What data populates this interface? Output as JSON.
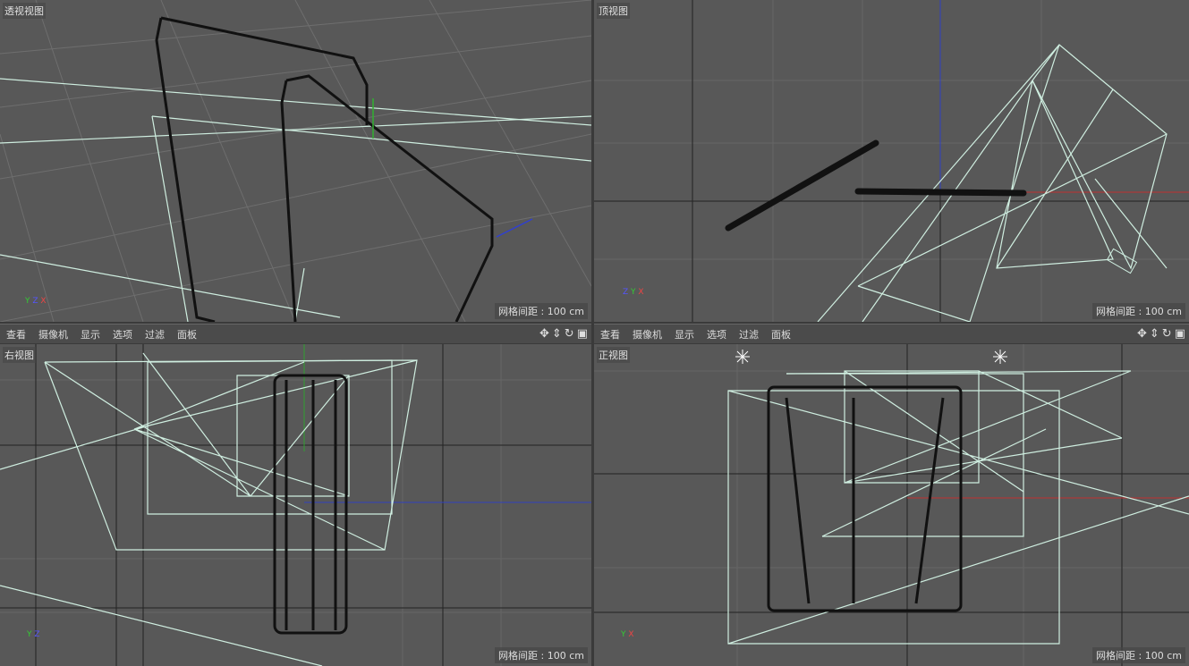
{
  "viewports": [
    {
      "label": "透视视图",
      "grid_spacing": "网格间距 : 100 cm",
      "axes": [
        "Y",
        "Z",
        "X"
      ]
    },
    {
      "label": "顶视图",
      "grid_spacing": "网格间距 : 100 cm",
      "axes": [
        "Z",
        "Y",
        "X"
      ]
    },
    {
      "label": "右视图",
      "grid_spacing": "网格间距 : 100 cm",
      "axes": [
        "Y",
        "Z"
      ]
    },
    {
      "label": "正视图",
      "grid_spacing": "网格间距 : 100 cm",
      "axes": [
        "Y",
        "X"
      ]
    }
  ],
  "menu": [
    "查看",
    "摄像机",
    "显示",
    "选项",
    "过滤",
    "面板"
  ],
  "tools": [
    "move-view-icon",
    "zoom-view-icon",
    "rotate-view-icon",
    "layout-toggle-icon"
  ],
  "colors": {
    "viewport_bg": "#585858",
    "wire": "#cfeee0",
    "x_axis": "#c03030",
    "y_axis": "#30a030",
    "z_axis": "#3040c0"
  }
}
